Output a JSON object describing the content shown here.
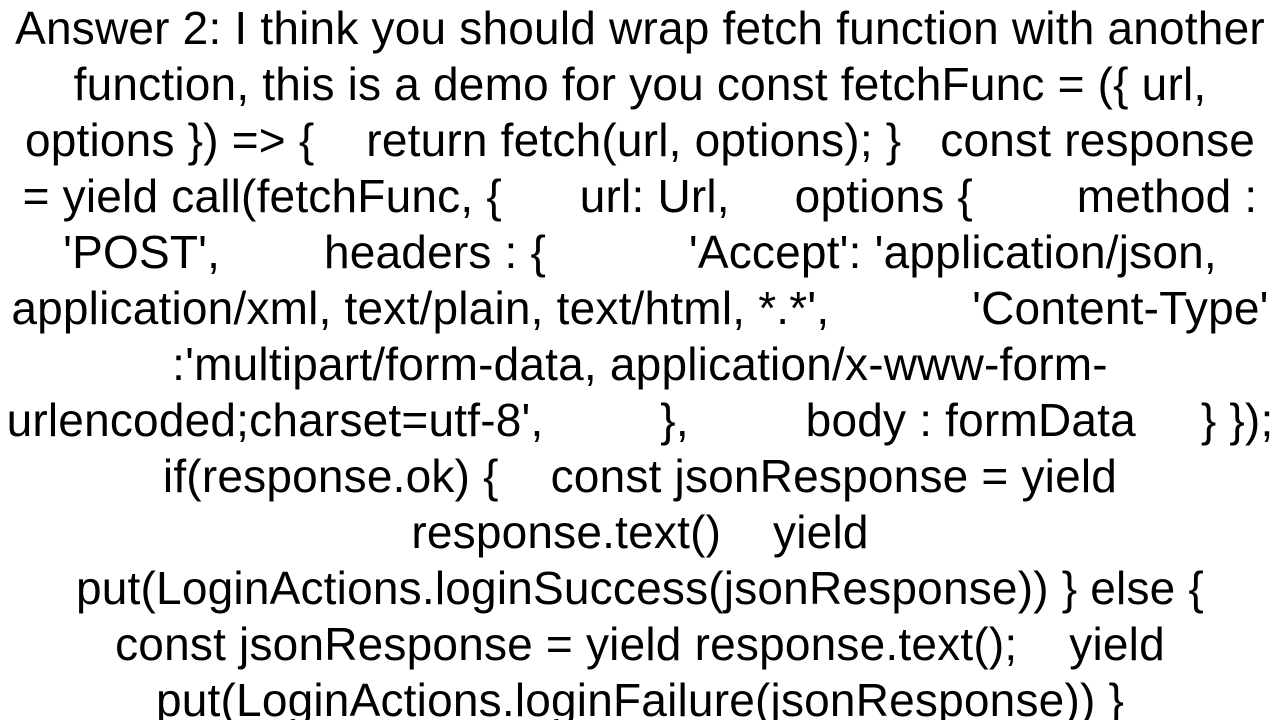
{
  "answer": {
    "text": "Answer 2: I think you should wrap fetch function with another function, this is a demo for you const fetchFunc = ({ url, options }) => {    return fetch(url, options); }   const response = yield call(fetchFunc, {      url: Url,     options {        method : 'POST',        headers : {           'Accept': 'application/json, application/xml, text/plain, text/html, *.*',           'Content-Type' :'multipart/form-data, application/x-www-form-urlencoded;charset=utf-8',         },         body : formData     } });  if(response.ok) {    const jsonResponse = yield response.text()    yield put(LoginActions.loginSuccess(jsonResponse)) } else {    const jsonResponse = yield response.text();    yield put(LoginActions.loginFailure(jsonResponse)) }"
  }
}
